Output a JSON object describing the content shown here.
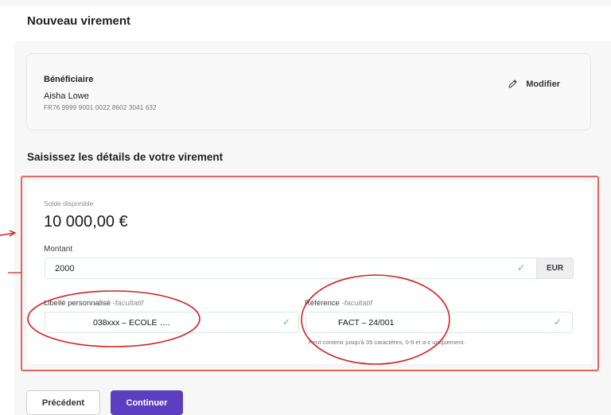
{
  "page": {
    "title": "Nouveau virement"
  },
  "beneficiary": {
    "label": "Bénéficiaire",
    "name": "Aisha Lowe",
    "iban": "FR76 9999 9001 0022 8602 3041 632",
    "modify_label": "Modifier",
    "modify_icon": "pencil-icon"
  },
  "details": {
    "title": "Saisissez les détails de votre virement",
    "balance_label": "Solde disponible",
    "balance_value": "10 000,00 €",
    "amount": {
      "label": "Montant",
      "value": "2000",
      "currency": "EUR"
    },
    "custom_label": {
      "label": "Libellé personnalisé ",
      "optional": "-facultatif",
      "value": "038xxx – ECOLE …."
    },
    "reference": {
      "label": "Référence ",
      "optional": "-facultatif",
      "value": "FACT – 24/001",
      "hint": "Peut contenir jusqu'à 35 caractères, 0-9 et a-z uniquement."
    },
    "valid_icon": "checkmark-icon"
  },
  "buttons": {
    "previous": "Précédent",
    "continue": "Continuer"
  },
  "colors": {
    "accent": "#5b3fc0",
    "annotation": "#d42020",
    "frame": "#e0665e",
    "valid": "#4cbf8a"
  }
}
